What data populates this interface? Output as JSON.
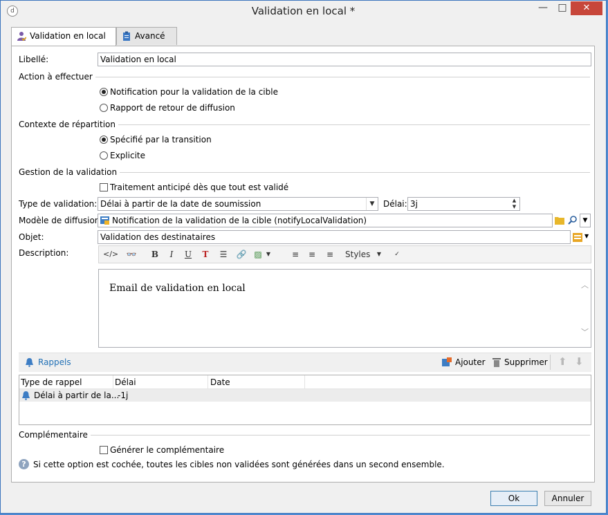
{
  "window": {
    "title": "Validation en local *",
    "minimize": "—",
    "maximize": "□",
    "close": "✕"
  },
  "tabs": [
    {
      "label": "Validation en local",
      "icon": "user-check-icon"
    },
    {
      "label": "Avancé",
      "icon": "clipboard-icon"
    }
  ],
  "form": {
    "libelle_label": "Libellé:",
    "libelle_value": "Validation en local",
    "action_section": "Action à effectuer",
    "action_opt1": "Notification pour la validation de la cible",
    "action_opt2": "Rapport de retour de diffusion",
    "contexte_section": "Contexte de répartition",
    "contexte_opt1": "Spécifié par la transition",
    "contexte_opt2": "Explicite",
    "gestion_section": "Gestion de la validation",
    "traitement_label": "Traitement anticipé dès que tout est validé",
    "type_validation_label": "Type de validation:",
    "type_validation_value": "Délai à partir de la date de soumission",
    "delai_label": "Délai:",
    "delai_value": "3j",
    "modele_label": "Modèle de diffusion:",
    "modele_value": "Notification de la validation de la cible (notifyLocalValidation)",
    "objet_label": "Objet:",
    "objet_value": "Validation des destinataires",
    "description_label": "Description:",
    "editor_text": "Email de validation en local",
    "styles_label": "Styles"
  },
  "rappels": {
    "title": "Rappels",
    "ajouter": "Ajouter",
    "supprimer": "Supprimer",
    "columns": [
      "Type de rappel",
      "Délai",
      "Date"
    ],
    "rows": [
      {
        "type": "Délai à partir de la...",
        "delai": "-1j",
        "date": ""
      }
    ]
  },
  "complementaire": {
    "section": "Complémentaire",
    "checkbox_label": "Générer le complémentaire",
    "info": "Si cette option est cochée, toutes les cibles non validées sont générées dans un second ensemble."
  },
  "buttons": {
    "ok": "Ok",
    "annuler": "Annuler"
  },
  "colors": {
    "accent": "#1f6fb5",
    "close": "#c7463a"
  }
}
